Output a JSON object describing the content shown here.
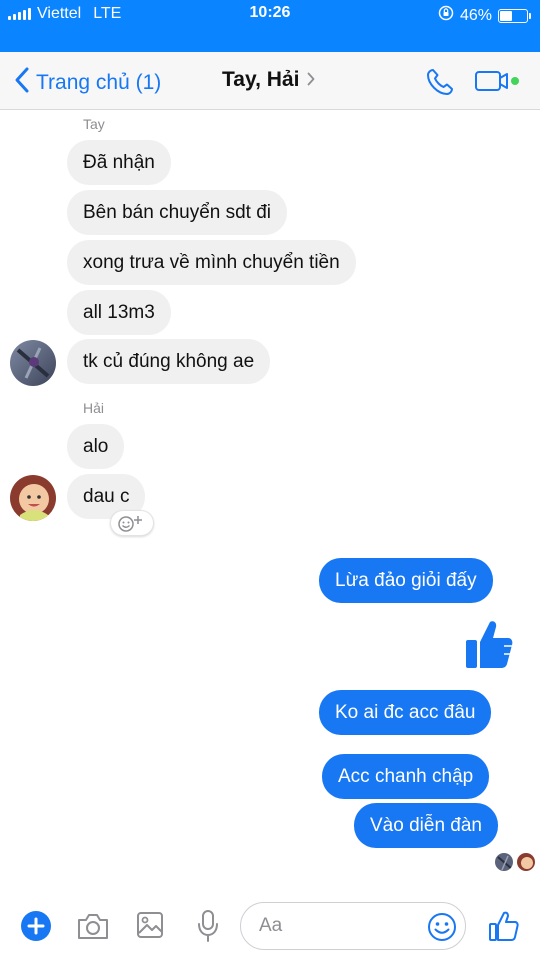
{
  "status_bar": {
    "carrier": "Viettel",
    "network": "LTE",
    "time": "10:26",
    "battery_percent": "46%",
    "battery_level": 0.46,
    "icons": [
      "signal-bars-icon",
      "rotation-lock-icon",
      "battery-icon"
    ]
  },
  "header": {
    "back_label": "Trang chủ (1)",
    "title": "Tay, Hải",
    "icons": [
      "back-chevron-icon",
      "title-chevron-icon",
      "phone-icon",
      "video-call-icon",
      "active-dot-icon"
    ]
  },
  "conversation": {
    "groups": [
      {
        "sender": "Tay",
        "avatar_icon": "avatar-tay-icon",
        "messages": [
          "Đã nhận",
          "Bên bán chuyển sdt đi",
          "xong trưa về mình chuyển tiền",
          "all 13m3",
          "tk củ đúng không ae"
        ]
      },
      {
        "sender": "Hải",
        "avatar_icon": "avatar-hai-icon",
        "messages": [
          "alo",
          "dau c"
        ],
        "reaction_icon": "add-reaction-icon"
      }
    ],
    "outgoing": [
      "Lừa đảo giỏi đấy",
      "Ko ai đc acc đâu",
      "Acc chanh chập",
      "Vào diễn đàn"
    ],
    "sticker_icon": "thumbs-up-icon",
    "seen_by_icons": [
      "seen-avatar-tay-icon",
      "seen-avatar-hai-icon"
    ]
  },
  "composer": {
    "placeholder": "Aa",
    "value": "",
    "icons": [
      "plus-icon",
      "camera-icon",
      "image-icon",
      "microphone-icon",
      "emoji-icon",
      "like-icon"
    ]
  },
  "colors": {
    "brand_blue": "#1877f2",
    "status_blue": "#0a84ff",
    "incoming_bubble": "#f1f0f0",
    "active_green": "#44d35b"
  }
}
